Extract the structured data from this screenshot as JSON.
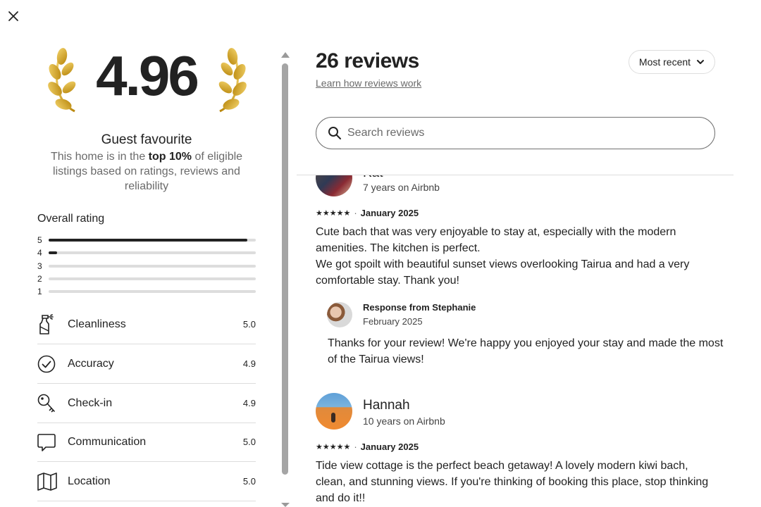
{
  "modal": {
    "close_icon": "close-icon"
  },
  "summary": {
    "rating": "4.96",
    "badge_title": "Guest favourite",
    "badge_desc_pre": "This home is in the ",
    "badge_desc_bold": "top 10%",
    "badge_desc_post": " of eligible listings based on ratings, reviews and reliability",
    "laurel_color": "#c9a227"
  },
  "overall": {
    "title": "Overall rating",
    "rows": [
      {
        "label": "5",
        "fraction": 0.96
      },
      {
        "label": "4",
        "fraction": 0.04
      },
      {
        "label": "3",
        "fraction": 0
      },
      {
        "label": "2",
        "fraction": 0
      },
      {
        "label": "1",
        "fraction": 0
      }
    ]
  },
  "categories": [
    {
      "label": "Cleanliness",
      "score": "5.0",
      "icon": "spray-bottle-icon"
    },
    {
      "label": "Accuracy",
      "score": "4.9",
      "icon": "check-circle-icon"
    },
    {
      "label": "Check-in",
      "score": "4.9",
      "icon": "key-icon"
    },
    {
      "label": "Communication",
      "score": "5.0",
      "icon": "chat-bubble-icon"
    },
    {
      "label": "Location",
      "score": "5.0",
      "icon": "map-icon"
    }
  ],
  "reviews_header": {
    "title": "26 reviews",
    "learn_link": "Learn how reviews work",
    "sort_label": "Most recent"
  },
  "search": {
    "placeholder": "Search reviews",
    "value": ""
  },
  "reviews": [
    {
      "name": "Kat",
      "meta": "7 years on Airbnb",
      "stars": "★★★★★",
      "date": "January 2025",
      "text_lines": [
        "Cute bach that was very enjoyable to stay at, especially with the modern",
        "amenities. The kitchen is perfect.",
        "We got spoilt with beautiful sunset views overlooking Tairua and had a very",
        "comfortable stay.  Thank you!"
      ],
      "response": {
        "from": "Response from Stephanie",
        "date": "February 2025",
        "text_lines": [
          "Thanks for your review! We're happy you enjoyed your stay and made the most",
          "of the Tairua views!"
        ]
      }
    },
    {
      "name": "Hannah",
      "meta": "10 years on Airbnb",
      "stars": "★★★★★",
      "date": "January 2025",
      "text_lines": [
        "Tide view cottage is the perfect beach getaway! A lovely modern kiwi bach,",
        "clean, and stunning views. If you're thinking of booking this place, stop thinking",
        "and do it!!"
      ]
    }
  ]
}
